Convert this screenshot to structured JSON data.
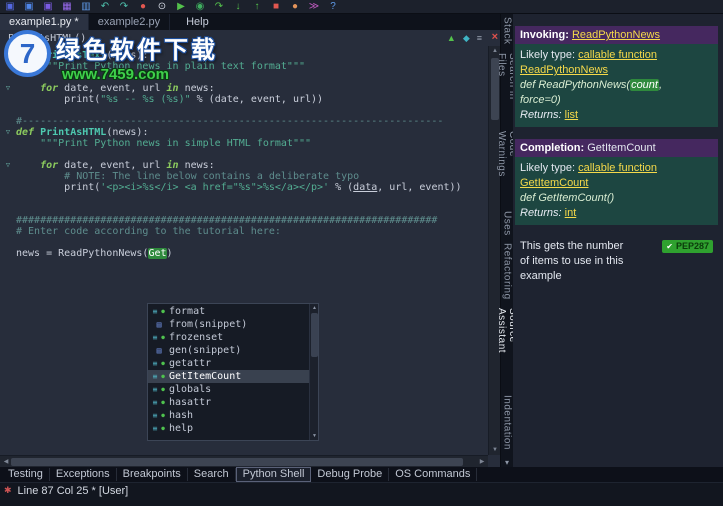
{
  "watermark": {
    "logo_text": "7",
    "title": "绿色软件下载",
    "url": "www.7459.com"
  },
  "scrollbar": {
    "up": "▲",
    "down": "▼",
    "left": "◀",
    "right": "▶"
  },
  "toolbar": {
    "icons": [
      {
        "name": "new-file-icon",
        "glyph": "▣",
        "color": "#5468e0"
      },
      {
        "name": "open-file-icon",
        "glyph": "▣",
        "color": "#4f86e8"
      },
      {
        "name": "save-icon",
        "glyph": "▣",
        "color": "#7b5be4"
      },
      {
        "name": "save-all-icon",
        "glyph": "▦",
        "color": "#9a6bf0"
      },
      {
        "name": "print-icon",
        "glyph": "▥",
        "color": "#5f9bea"
      },
      {
        "name": "undo-icon",
        "glyph": "↶",
        "color": "#4fc2ae"
      },
      {
        "name": "redo-icon",
        "glyph": "↷",
        "color": "#4fc2ae"
      },
      {
        "name": "record-macro-icon",
        "glyph": "●",
        "color": "#e25750"
      },
      {
        "name": "search-icon",
        "glyph": "⊙",
        "color": "#d6dbe6"
      },
      {
        "name": "run-icon",
        "glyph": "▶",
        "color": "#54c24c"
      },
      {
        "name": "debug-icon",
        "glyph": "◉",
        "color": "#3fae5f"
      },
      {
        "name": "step-over-icon",
        "glyph": "↷",
        "color": "#54c24c"
      },
      {
        "name": "step-into-icon",
        "glyph": "↓",
        "color": "#54c24c"
      },
      {
        "name": "step-out-icon",
        "glyph": "↑",
        "color": "#54c24c"
      },
      {
        "name": "stop-icon",
        "glyph": "■",
        "color": "#e25750"
      },
      {
        "name": "breakpoint-icon",
        "glyph": "●",
        "color": "#e2935a"
      },
      {
        "name": "python-shell-icon",
        "glyph": "≫",
        "color": "#c05bc0"
      },
      {
        "name": "help-icon",
        "glyph": "?",
        "color": "#5f9bea"
      }
    ]
  },
  "tab_bar": {
    "tabs": [
      {
        "label": "example1.py *",
        "active": true
      },
      {
        "label": "example2.py",
        "active": false
      }
    ],
    "help_menu": "Help"
  },
  "editor": {
    "header": {
      "breadcrumb": "PrintAsHTML()",
      "close_glyph": "×",
      "icons": [
        {
          "name": "goto-definition-icon",
          "glyph": "▲",
          "color": "#54c24c"
        },
        {
          "name": "bookmark-icon",
          "glyph": "◆",
          "color": "#3fb4c4"
        },
        {
          "name": "editor-menu-icon",
          "glyph": "≡",
          "color": "#9aa3b2"
        }
      ]
    },
    "fold_glyph": "▽",
    "lines": [
      {
        "fold": true,
        "tokens": [
          {
            "s": "kw",
            "t": "def "
          },
          {
            "s": "fn",
            "t": "PrintAsText"
          },
          {
            "s": "txt",
            "t": "(news):"
          }
        ]
      },
      {
        "tokens": [
          {
            "s": "str",
            "t": "    \"\"\"Print Python news in plain text format\"\"\""
          }
        ]
      },
      {
        "tokens": []
      },
      {
        "fold": true,
        "tokens": [
          {
            "s": "txt",
            "t": "    "
          },
          {
            "s": "kw",
            "t": "for"
          },
          {
            "s": "txt",
            "t": " date, event, url "
          },
          {
            "s": "kw",
            "t": "in"
          },
          {
            "s": "txt",
            "t": " news:"
          }
        ]
      },
      {
        "tokens": [
          {
            "s": "txt",
            "t": "        print("
          },
          {
            "s": "str",
            "t": "\"%s -- %s (%s)\""
          },
          {
            "s": "txt",
            "t": " % (date, event, url))"
          }
        ]
      },
      {
        "tokens": []
      },
      {
        "tokens": [
          {
            "s": "com",
            "t": "#----------------------------------------------------------------------"
          }
        ]
      },
      {
        "fold": true,
        "tokens": [
          {
            "s": "kw",
            "t": "def "
          },
          {
            "s": "fn",
            "t": "PrintAsHTML"
          },
          {
            "s": "txt",
            "t": "(news):"
          }
        ]
      },
      {
        "tokens": [
          {
            "s": "str",
            "t": "    \"\"\"Print Python news in simple HTML format\"\"\""
          }
        ]
      },
      {
        "tokens": []
      },
      {
        "fold": true,
        "tokens": [
          {
            "s": "txt",
            "t": "    "
          },
          {
            "s": "kw",
            "t": "for"
          },
          {
            "s": "txt",
            "t": " date, event, url "
          },
          {
            "s": "kw",
            "t": "in"
          },
          {
            "s": "txt",
            "t": " news:"
          }
        ]
      },
      {
        "tokens": [
          {
            "s": "com",
            "t": "        # NOTE: The line below contains a deliberate typo"
          }
        ]
      },
      {
        "tokens": [
          {
            "s": "txt",
            "t": "        print("
          },
          {
            "s": "str",
            "t": "'<p><i>%s</i> <a href=\"%s\">%s</a></p>'"
          },
          {
            "s": "txt",
            "t": " % ("
          },
          {
            "s": "err",
            "t": "data"
          },
          {
            "s": "txt",
            "t": ", url, event))"
          }
        ]
      },
      {
        "tokens": []
      },
      {
        "tokens": []
      },
      {
        "tokens": [
          {
            "s": "com",
            "t": "######################################################################"
          }
        ]
      },
      {
        "tokens": [
          {
            "s": "com",
            "t": "# Enter code according to the tutorial here:"
          }
        ]
      },
      {
        "tokens": []
      },
      {
        "tokens": [
          {
            "s": "txt",
            "t": "news = ReadPythonNews("
          },
          {
            "s": "hl",
            "t": "Get"
          },
          {
            "s": "txt",
            "t": ")"
          }
        ]
      }
    ],
    "completion": {
      "items": [
        {
          "label": "format",
          "kind": "callable"
        },
        {
          "label": "from(snippet)",
          "kind": "snippet"
        },
        {
          "label": "frozenset",
          "kind": "callable"
        },
        {
          "label": "gen(snippet)",
          "kind": "snippet"
        },
        {
          "label": "getattr",
          "kind": "callable"
        },
        {
          "label": "GetItemCount",
          "kind": "callable",
          "selected": true
        },
        {
          "label": "globals",
          "kind": "callable"
        },
        {
          "label": "hasattr",
          "kind": "callable"
        },
        {
          "label": "hash",
          "kind": "callable"
        },
        {
          "label": "help",
          "kind": "callable"
        }
      ]
    }
  },
  "right_tab_strip": {
    "chevron": "▾",
    "tabs": [
      {
        "label": "Stack"
      },
      {
        "label": "Search in Files"
      },
      {
        "label": "Code Warnings"
      },
      {
        "label": "Uses"
      },
      {
        "label": "Refactoring"
      },
      {
        "label": "Source Assistant",
        "active": true
      },
      {
        "label": "Indentation"
      }
    ]
  },
  "assistant": {
    "sections": [
      {
        "kind": "header",
        "lines": [
          [
            {
              "s": "b",
              "t": "Invoking: "
            },
            {
              "s": "link",
              "t": "ReadPythonNews"
            }
          ]
        ]
      },
      {
        "kind": "body",
        "lines": [
          [
            {
              "s": "p",
              "t": "Likely type: "
            },
            {
              "s": "link",
              "t": "callable function"
            }
          ],
          [
            {
              "s": "link",
              "t": "ReadPythonNews"
            }
          ],
          [
            {
              "s": "sig",
              "t": "def ReadPythonNews("
            },
            {
              "s": "sighl",
              "t": "count"
            },
            {
              "s": "sig",
              "t": ","
            }
          ],
          [
            {
              "s": "sig",
              "t": "force=0)"
            }
          ],
          [
            {
              "s": "it",
              "t": "Returns: "
            },
            {
              "s": "link",
              "t": "list"
            }
          ]
        ]
      },
      {
        "kind": "header",
        "lines": [
          [
            {
              "s": "b",
              "t": "Completion: "
            },
            {
              "s": "p",
              "t": "GetItemCount"
            }
          ]
        ]
      },
      {
        "kind": "body",
        "lines": [
          [
            {
              "s": "p",
              "t": "Likely type: "
            },
            {
              "s": "link",
              "t": "callable function"
            }
          ],
          [
            {
              "s": "link",
              "t": "GetItemCount"
            }
          ],
          [
            {
              "s": "sig",
              "t": "def GetItemCount()"
            }
          ],
          [
            {
              "s": "it",
              "t": "Returns: "
            },
            {
              "s": "link",
              "t": "int"
            }
          ]
        ]
      },
      {
        "kind": "note",
        "badge": "PEP287",
        "badge_check": "✔",
        "lines": [
          [
            {
              "s": "p",
              "t": "This gets the number"
            }
          ],
          [
            {
              "s": "p",
              "t": "of items to use in this"
            }
          ],
          [
            {
              "s": "p",
              "t": "example"
            }
          ]
        ]
      }
    ]
  },
  "bottom_tabs": {
    "tabs": [
      {
        "label": "Testing"
      },
      {
        "label": "Exceptions"
      },
      {
        "label": "Breakpoints"
      },
      {
        "label": "Search"
      },
      {
        "label": "Python Shell",
        "active": true
      },
      {
        "label": "Debug Probe"
      },
      {
        "label": "OS Commands"
      }
    ]
  },
  "status": {
    "icon": "✱",
    "text": "Line 87 Col 25 * [User]"
  }
}
